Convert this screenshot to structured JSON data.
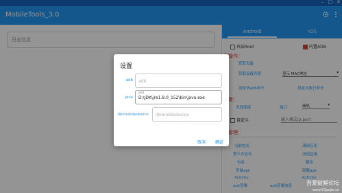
{
  "window": {
    "controls": [
      "–",
      "□",
      "✕"
    ]
  },
  "app": {
    "title": "MobileTools_3.0",
    "icons": [
      "gear-icon",
      "more-vert-icon"
    ]
  },
  "left": {
    "log_placeholder": "日志信息"
  },
  "right": {
    "tabs": [
      {
        "label": "Android",
        "active": true
      },
      {
        "label": "iOS",
        "active": false
      }
    ],
    "options": {
      "open_root": "开启Root",
      "builtin_adb": "内置ADB",
      "builtin_adb_checked": true
    },
    "section_ops": "基操作：",
    "get_device": "获取设备",
    "get_device_list": "获取设备列表",
    "device_mac_select": "显示 MAC地址",
    "set_adb_cmd": "设定法adb命令",
    "set_custom_cmd": "设定义执行命令",
    "section_connect": "连接：",
    "wireless_connect": "无线连接",
    "port_label": "端口",
    "port_select": "商机",
    "custom_label": "自定义",
    "custom_input_placeholder": "输入格式ip:port",
    "section_manage": "理管理：",
    "actions": [
      [
        "当前包名",
        "清除应用"
      ],
      [
        "第三方包名",
        "冻结应用"
      ],
      [
        "包名",
        "解冻"
      ],
      [
        "安装apk",
        "卸载apk"
      ],
      [
        "Activity",
        "Activity"
      ],
      [
        "apk签署",
        "apk签署信息"
      ]
    ]
  },
  "dialog": {
    "title": "设置",
    "fields": [
      {
        "label": "adb",
        "placeholder": "adb",
        "value": "",
        "float_label": ""
      },
      {
        "label": "java",
        "placeholder": "",
        "value": "D:\\JDK\\jre1.8.0_152\\bin\\java.exe",
        "float_label": "java"
      },
      {
        "label": "libimobiledevice",
        "placeholder": "libimobiledevice",
        "value": "",
        "float_label": ""
      }
    ],
    "cancel": "取消",
    "ok": "确定"
  },
  "watermark": {
    "line1": "吾爱破解论坛",
    "line2": "www.52pojie.cn"
  }
}
